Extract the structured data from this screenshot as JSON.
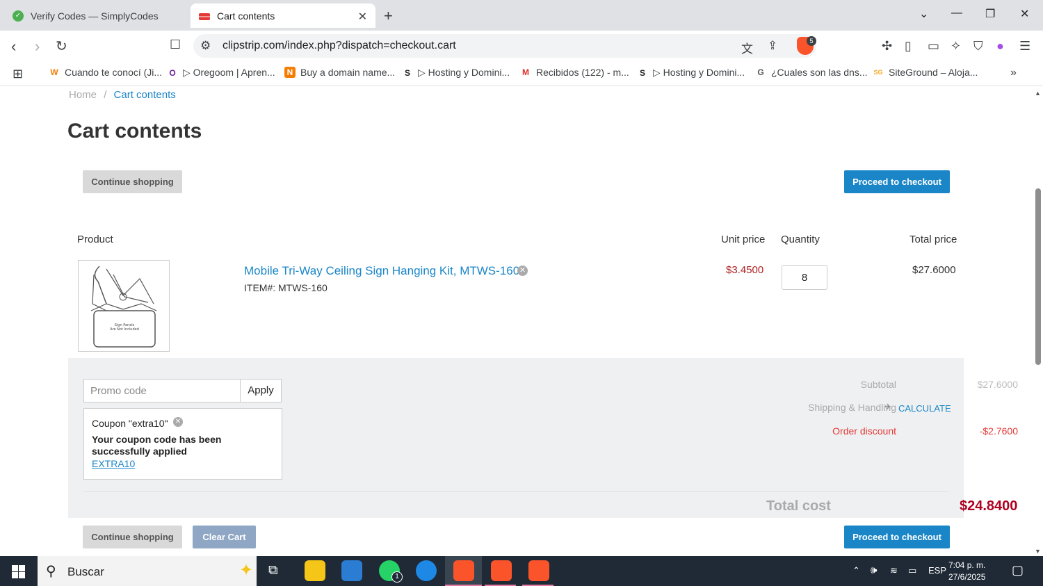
{
  "browser": {
    "tabs": [
      {
        "label": "Verify Codes — SimplyCodes",
        "active": false
      },
      {
        "label": "Cart contents",
        "active": true
      }
    ],
    "url": "clipstrip.com/index.php?dispatch=checkout.cart",
    "brave_badge": "5",
    "bookmarks": [
      {
        "label": "Cuando te conocí (Ji...",
        "icon": "W"
      },
      {
        "label": "▷ Oregoom | Apren...",
        "icon": "O"
      },
      {
        "label": "Buy a domain name...",
        "icon": "N"
      },
      {
        "label": "▷ Hosting y Domini...",
        "icon": "S"
      },
      {
        "label": "Recibidos (122) - m...",
        "icon": "M"
      },
      {
        "label": "▷ Hosting y Domini...",
        "icon": "S"
      },
      {
        "label": "¿Cuales son las dns...",
        "icon": "G"
      },
      {
        "label": "SiteGround – Aloja...",
        "icon": "SG"
      }
    ]
  },
  "page": {
    "breadcrumb": {
      "home": "Home",
      "separator": "/",
      "current": "Cart contents"
    },
    "title": "Cart contents",
    "continue_shopping": "Continue shopping",
    "proceed_checkout": "Proceed to checkout",
    "clear_cart": "Clear Cart",
    "table_headers": {
      "product": "Product",
      "unit_price": "Unit price",
      "quantity": "Quantity",
      "total_price": "Total price"
    },
    "item": {
      "name": "Mobile Tri-Way Ceiling Sign Hanging Kit, MTWS-160",
      "code": "ITEM#: MTWS-160",
      "unit_price": "$3.4500",
      "quantity": "8",
      "total_price": "$27.6000",
      "image_text_line1": "Sign Panels",
      "image_text_line2": "Are Not Included"
    },
    "promo": {
      "placeholder": "Promo code",
      "apply": "Apply",
      "coupon_label": "Coupon \"extra10\"",
      "message": "Your coupon code has been successfully applied",
      "code": "EXTRA10"
    },
    "summary": {
      "subtotal_label": "Subtotal",
      "subtotal_value": "$27.6000",
      "shipping_label": "Shipping & Handling",
      "shipping_value": "CALCULATE",
      "discount_label": "Order discount",
      "discount_value": "-$2.7600",
      "total_label": "Total cost",
      "total_value": "$24.8400"
    }
  },
  "taskbar": {
    "search_placeholder": "Buscar",
    "whatsapp_badge": "1",
    "language": "ESP",
    "time": "7:04 p. m.",
    "date": "27/6/2025"
  },
  "colors": {
    "link": "#1a86c8",
    "checkout_button": "#1a86c8",
    "price_red": "#b02121",
    "discount_red": "#e53935",
    "total_red": "#b00020"
  }
}
